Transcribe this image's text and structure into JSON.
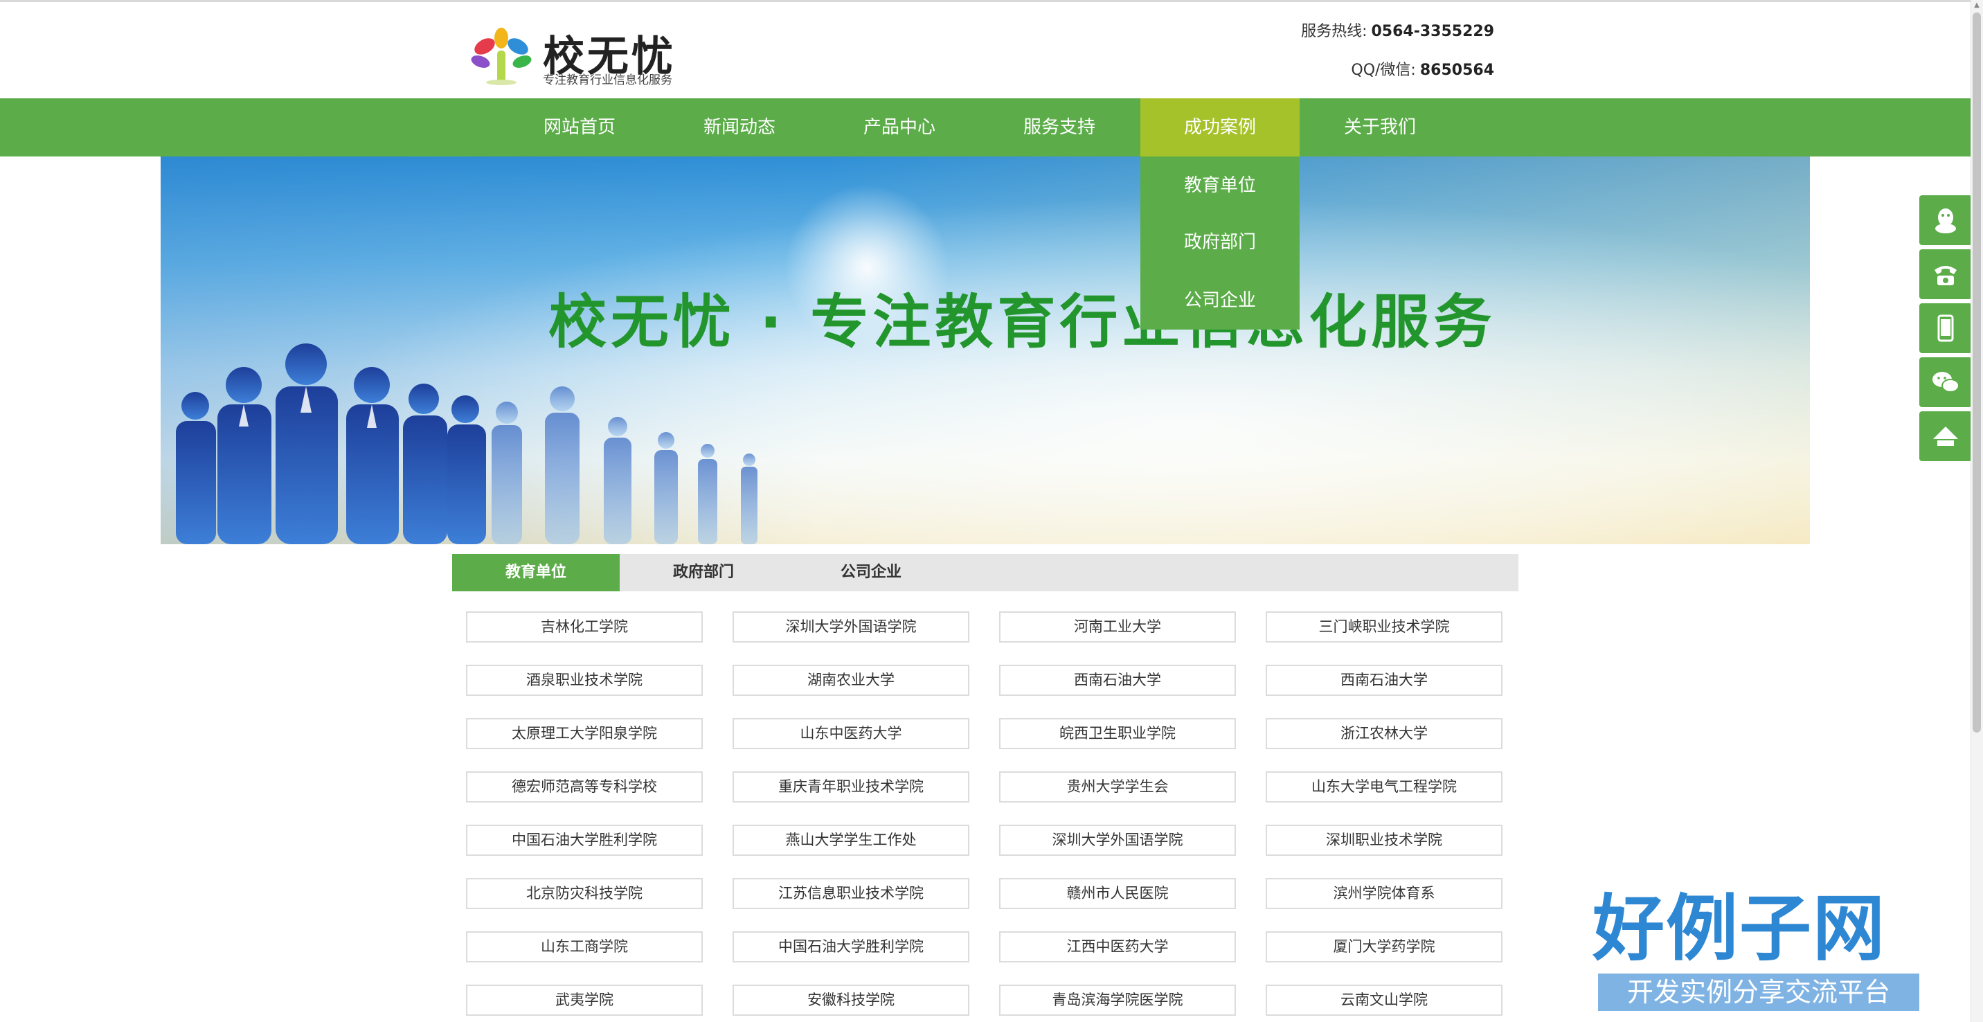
{
  "header": {
    "logo_title": "校无忧",
    "logo_sub": "专注教育行业信息化服务",
    "hotline_label": "服务热线:",
    "hotline_value": "0564-3355229",
    "qq_label": "QQ/微信:",
    "qq_value": "8650564"
  },
  "nav": {
    "items": [
      {
        "label": "网站首页"
      },
      {
        "label": "新闻动态"
      },
      {
        "label": "产品中心"
      },
      {
        "label": "服务支持"
      },
      {
        "label": "成功案例"
      },
      {
        "label": "关于我们"
      }
    ],
    "active_index": 4,
    "dropdown": [
      "教育单位",
      "政府部门",
      "公司企业"
    ]
  },
  "banner": {
    "title": "校无忧 · 专注教育行业信息化服务"
  },
  "tabs": {
    "items": [
      "教育单位",
      "政府部门",
      "公司企业"
    ],
    "active_index": 0
  },
  "cases": [
    [
      "吉林化工学院",
      "深圳大学外国语学院",
      "河南工业大学",
      "三门峡职业技术学院"
    ],
    [
      "酒泉职业技术学院",
      "湖南农业大学",
      "西南石油大学",
      "西南石油大学"
    ],
    [
      "太原理工大学阳泉学院",
      "山东中医药大学",
      "皖西卫生职业学院",
      "浙江农林大学"
    ],
    [
      "德宏师范高等专科学校",
      "重庆青年职业技术学院",
      "贵州大学学生会",
      "山东大学电气工程学院"
    ],
    [
      "中国石油大学胜利学院",
      "燕山大学学生工作处",
      "深圳大学外国语学院",
      "深圳职业技术学院"
    ],
    [
      "北京防灾科技学院",
      "江苏信息职业技术学院",
      "赣州市人民医院",
      "滨州学院体育系"
    ],
    [
      "山东工商学院",
      "中国石油大学胜利学院",
      "江西中医药大学",
      "厦门大学药学院"
    ],
    [
      "武夷学院",
      "安徽科技学院",
      "青岛滨海学院医学院",
      "云南文山学院"
    ]
  ],
  "watermark": {
    "title": "好例子网",
    "subtitle": "开发实例分享交流平台"
  },
  "colors": {
    "brand_green": "#5cad4a",
    "active_nav": "#a6c22a",
    "banner_text": "#22962c",
    "watermark_blue": "#2d87d3"
  },
  "side_icons": [
    "qq-icon",
    "phone-icon",
    "mobile-icon",
    "wechat-icon",
    "back-to-top-icon"
  ]
}
